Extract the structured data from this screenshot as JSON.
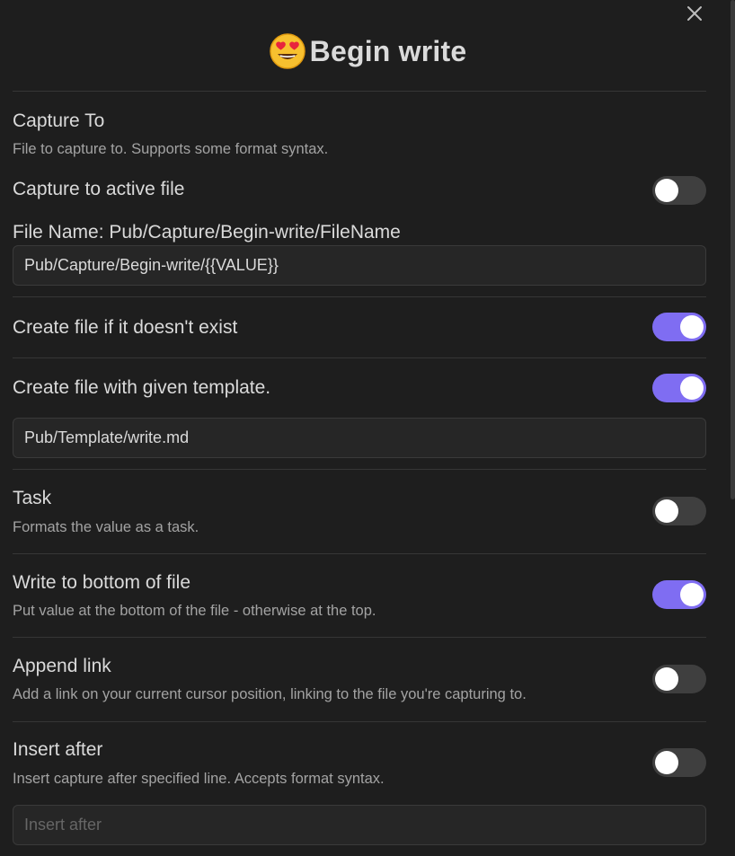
{
  "modal": {
    "title": "Begin write",
    "title_emoji": "smiling-face-with-heart-eyes",
    "close_icon": "close-icon"
  },
  "colors": {
    "accent": "#7f6df2",
    "background": "#1e1e1e",
    "toggle_off": "#3f3f3f",
    "input_bg": "#262626"
  },
  "settings": {
    "capture_to": {
      "name": "Capture To",
      "desc": "File to capture to. Supports some format syntax."
    },
    "capture_active": {
      "name": "Capture to active file",
      "enabled": false
    },
    "file_name": {
      "label": "File Name: Pub/Capture/Begin-write/FileName",
      "value": "Pub/Capture/Begin-write/{{VALUE}}"
    },
    "create_if_missing": {
      "name": "Create file if it doesn't exist",
      "enabled": true
    },
    "create_with_template": {
      "name": "Create file with given template.",
      "enabled": true,
      "template_path": "Pub/Template/write.md"
    },
    "task": {
      "name": "Task",
      "desc": "Formats the value as a task.",
      "enabled": false
    },
    "write_bottom": {
      "name": "Write to bottom of file",
      "desc": "Put value at the bottom of the file - otherwise at the top.",
      "enabled": true
    },
    "append_link": {
      "name": "Append link",
      "desc": "Add a link on your current cursor position, linking to the file you're capturing to.",
      "enabled": false
    },
    "insert_after": {
      "name": "Insert after",
      "desc": "Insert capture after specified line. Accepts format syntax.",
      "enabled": false,
      "placeholder": "Insert after",
      "value": ""
    }
  }
}
